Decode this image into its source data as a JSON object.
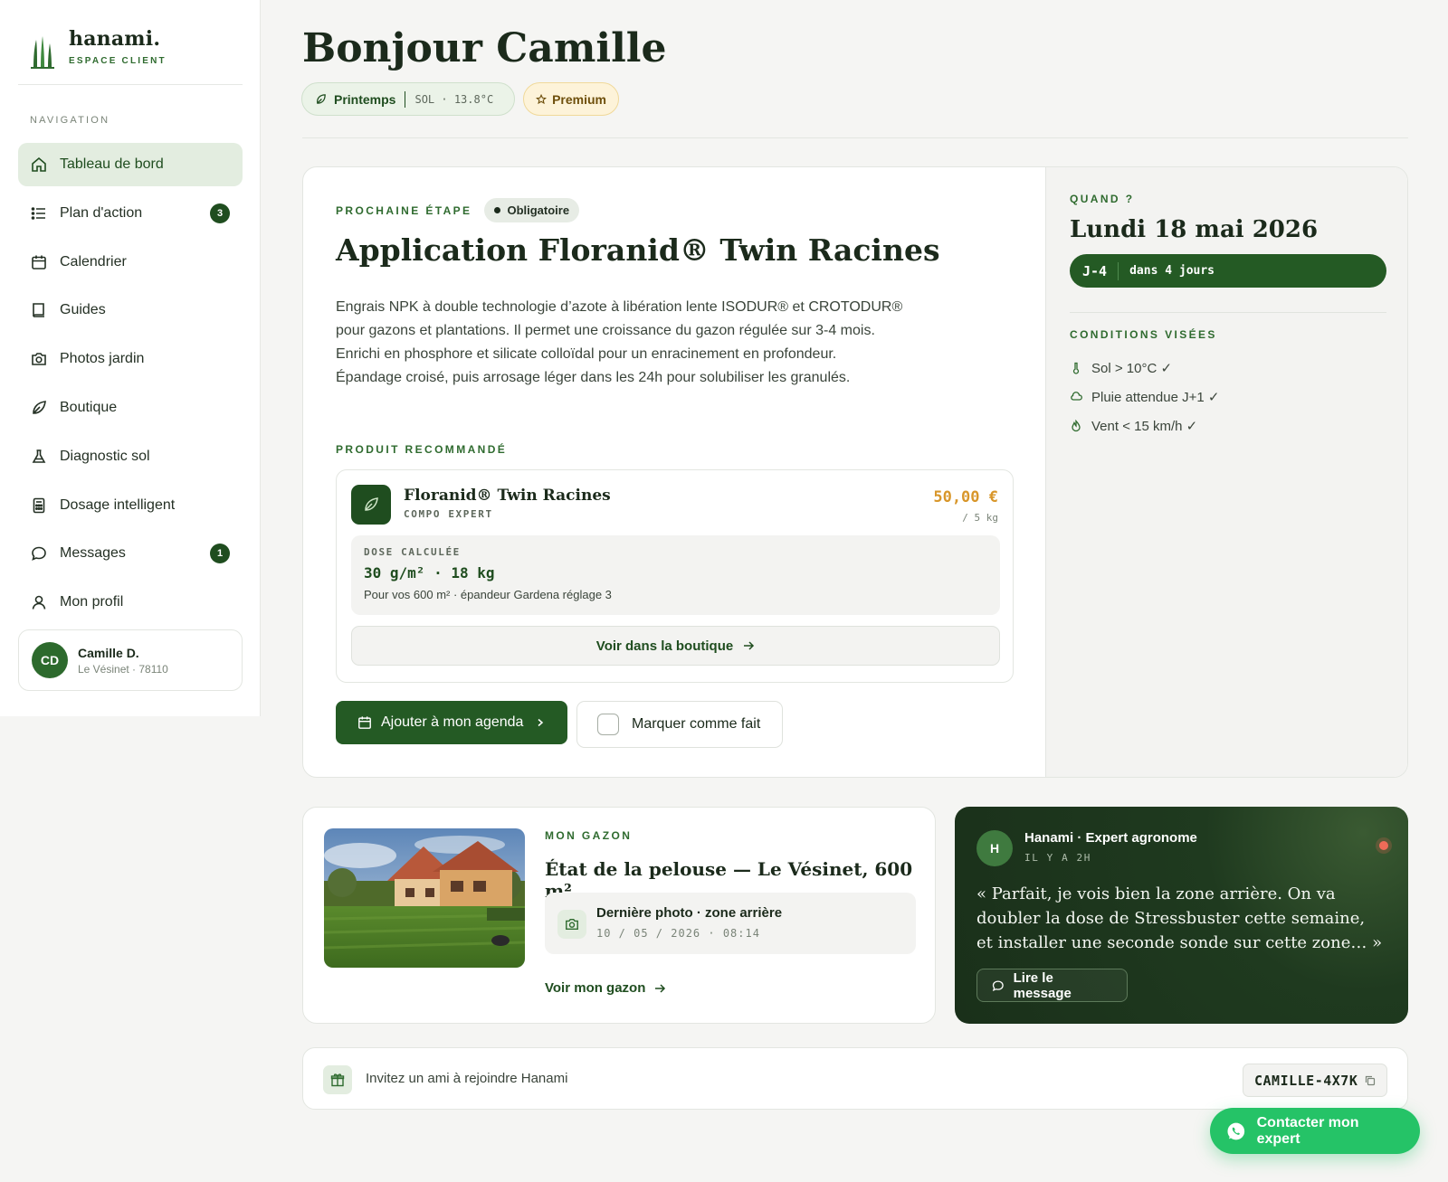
{
  "brand": {
    "name": "hanami.",
    "subtitle": "ESPACE CLIENT"
  },
  "sidebar": {
    "section_title": "NAVIGATION",
    "items": [
      {
        "label": "Tableau de bord",
        "icon": "home-icon",
        "active": true,
        "badge": ""
      },
      {
        "label": "Plan d'action",
        "icon": "list-icon",
        "active": false,
        "badge": "3"
      },
      {
        "label": "Calendrier",
        "icon": "calendar-icon",
        "active": false,
        "badge": ""
      },
      {
        "label": "Guides",
        "icon": "book-icon",
        "active": false,
        "badge": ""
      },
      {
        "label": "Photos jardin",
        "icon": "camera-icon",
        "active": false,
        "badge": ""
      },
      {
        "label": "Boutique",
        "icon": "leaf-icon",
        "active": false,
        "badge": ""
      },
      {
        "label": "Diagnostic sol",
        "icon": "flask-icon",
        "active": false,
        "badge": ""
      },
      {
        "label": "Dosage intelligent",
        "icon": "calculator-icon",
        "active": false,
        "badge": ""
      },
      {
        "label": "Messages",
        "icon": "chat-icon",
        "active": false,
        "badge": "1"
      },
      {
        "label": "Mon profil",
        "icon": "user-icon",
        "active": false,
        "badge": ""
      }
    ],
    "user": {
      "initials": "CD",
      "name": "Camille D.",
      "location": "Le Vésinet · 78110"
    }
  },
  "header": {
    "title": "Bonjour Camille",
    "season_chip": {
      "label": "Printemps",
      "soil": "SOL · 13.8°C"
    },
    "plan_chip": "Premium"
  },
  "next_step": {
    "eyebrow": "PROCHAINE ÉTAPE",
    "tag": "Obligatoire",
    "title": "Application Floranid® Twin Racines",
    "description": "Engrais NPK à double technologie d’azote à libération lente ISODUR® et CROTODUR® pour gazons et plantations. Il permet une croissance du gazon régulée sur 3-4 mois. Enrichi en phosphore et silicate colloïdal pour un enracinement en profondeur. Épandage croisé, puis arrosage léger dans les 24h pour solubiliser les granulés.",
    "product_eyebrow": "PRODUIT RECOMMANDÉ",
    "product": {
      "name": "Floranid® Twin Racines",
      "brand": "COMPO EXPERT",
      "price": "50,00 €",
      "unit": "/ 5 kg",
      "dose_label": "DOSE CALCULÉE",
      "dose_value": "30 g/m² · 18 kg",
      "dose_note": "Pour vos 600 m² · épandeur Gardena réglage 3",
      "shop_button": "Voir dans la boutique"
    },
    "primary_button": "Ajouter à mon agenda",
    "secondary_button": "Marquer comme fait",
    "when": {
      "eyebrow": "QUAND ?",
      "date": "Lundi 18 mai 2026",
      "countdown": "J-4",
      "countdown_text": "dans 4 jours",
      "conditions_eyebrow": "CONDITIONS VISÉES",
      "conditions": [
        {
          "icon": "thermometer-icon",
          "label": "Sol > 10°C ✓"
        },
        {
          "icon": "cloud-rain-icon",
          "label": "Pluie attendue J+1 ✓"
        },
        {
          "icon": "wind-icon",
          "label": "Vent < 15 km/h ✓"
        }
      ]
    }
  },
  "lawn": {
    "eyebrow": "MON GAZON",
    "title": "État de la pelouse — Le Vésinet, 600 m²",
    "photo_title": "Dernière photo · zone arrière",
    "photo_date": "10 / 05 / 2026 · 08:14",
    "link": "Voir mon gazon"
  },
  "expert": {
    "initial": "H",
    "name": "Hanami · Expert agronome",
    "time": "IL Y A 2H",
    "quote": "« Parfait, je vois bien la zone arrière. On va doubler la dose de Stressbuster cette semaine, et installer une seconde sonde sur cette zone… »",
    "button": "Lire le message"
  },
  "invite": {
    "text": "Invitez un ami à rejoindre Hanami",
    "code": "CAMILLE-4X7K"
  },
  "fab": {
    "label": "Contacter mon expert"
  },
  "colors": {
    "brand_green": "#245a24",
    "accent_gold": "#d8962a",
    "whatsapp": "#25c367",
    "expert_bg": "#1a301a"
  }
}
